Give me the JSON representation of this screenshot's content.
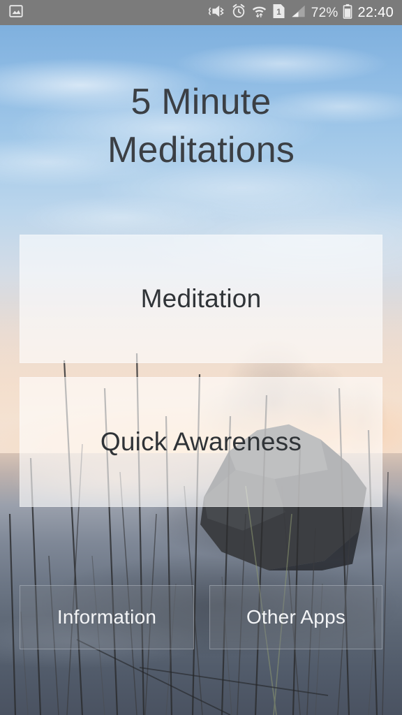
{
  "status_bar": {
    "notification_icon": "image-icon",
    "icons": [
      {
        "name": "vibrate-mute-icon"
      },
      {
        "name": "alarm-clock-icon"
      },
      {
        "name": "wifi-transfer-icon"
      },
      {
        "name": "sim-1-icon",
        "label": "1"
      },
      {
        "name": "cellular-signal-icon"
      }
    ],
    "battery_percent": "72%",
    "battery_icon": "battery-icon",
    "clock": "22:40"
  },
  "app": {
    "title": "5 Minute\nMeditations",
    "title_line1": "5 Minute",
    "title_line2": "Meditations"
  },
  "main_buttons": [
    {
      "name": "meditation",
      "label": "Meditation"
    },
    {
      "name": "quick-awareness",
      "label": "Quick Awareness"
    }
  ],
  "footer_buttons": [
    {
      "name": "information",
      "label": "Information"
    },
    {
      "name": "other-apps",
      "label": "Other Apps"
    }
  ],
  "colors": {
    "status_bar_bg": "#7b7b7b",
    "status_bar_text": "#f2f2f2",
    "title_text": "#3b3f44",
    "main_button_text": "#2f3337",
    "main_button_bg": "rgba(255,255,255,0.62)",
    "footer_button_text": "#f3f4f6",
    "footer_button_bg": "rgba(120,126,136,0.34)",
    "sky_top": "#7fb0de",
    "horizon": "#f6d3b2",
    "water_bottom": "#4a5261"
  }
}
